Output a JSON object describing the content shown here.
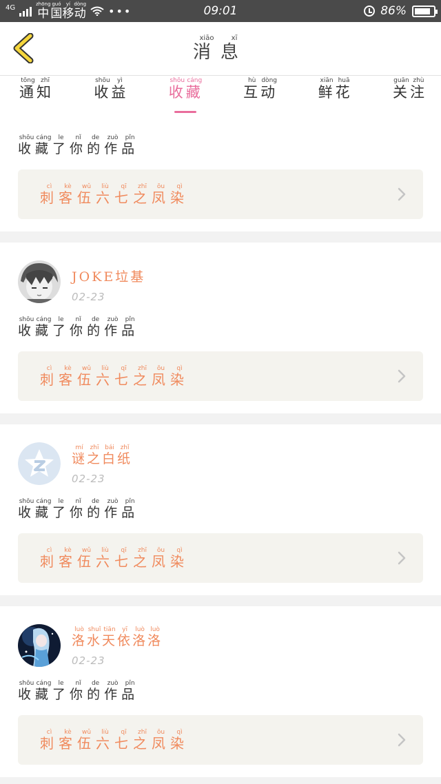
{
  "status_bar": {
    "network": "4G",
    "carrier": [
      {
        "ch": "中",
        "py": "zhōng"
      },
      {
        "ch": "国",
        "py": "guó"
      },
      {
        "ch": "移",
        "py": "yí"
      },
      {
        "ch": "动",
        "py": "dòng"
      }
    ],
    "dots": "•••",
    "time": "09:01",
    "battery": "86%",
    "battery_level": 0.86
  },
  "header": {
    "title": [
      {
        "ch": "消",
        "py": "xiāo"
      },
      {
        "ch": "息",
        "py": "xī"
      }
    ]
  },
  "tabs": [
    {
      "chars": [
        {
          "ch": "通",
          "py": "tōng"
        },
        {
          "ch": "知",
          "py": "zhī"
        }
      ],
      "active": false
    },
    {
      "chars": [
        {
          "ch": "收",
          "py": "shōu"
        },
        {
          "ch": "益",
          "py": "yì"
        }
      ],
      "active": false
    },
    {
      "chars": [
        {
          "ch": "收",
          "py": "shōu"
        },
        {
          "ch": "藏",
          "py": "cáng"
        }
      ],
      "active": true
    },
    {
      "chars": [
        {
          "ch": "互",
          "py": "hù"
        },
        {
          "ch": "动",
          "py": "dòng"
        }
      ],
      "active": false
    },
    {
      "chars": [
        {
          "ch": "鲜",
          "py": "xiān"
        },
        {
          "ch": "花",
          "py": "huā"
        }
      ],
      "active": false
    },
    {
      "chars": [
        {
          "ch": "关",
          "py": "guān"
        },
        {
          "ch": "注",
          "py": "zhù"
        }
      ],
      "active": false
    }
  ],
  "action_text": [
    {
      "ch": "收",
      "py": "shōu"
    },
    {
      "ch": "藏",
      "py": "cáng"
    },
    {
      "ch": "了",
      "py": "le"
    },
    {
      "ch": "你",
      "py": "nǐ"
    },
    {
      "ch": "的",
      "py": "de"
    },
    {
      "ch": "作",
      "py": "zuò"
    },
    {
      "ch": "品",
      "py": "pǐn"
    }
  ],
  "work_title": [
    {
      "ch": "刺",
      "py": "cì"
    },
    {
      "ch": "客",
      "py": "kè"
    },
    {
      "ch": "伍",
      "py": "wǔ"
    },
    {
      "ch": "六",
      "py": "liù"
    },
    {
      "ch": "七",
      "py": "qī"
    },
    {
      "ch": "之",
      "py": "zhī"
    },
    {
      "ch": "凤",
      "py": "ōu"
    },
    {
      "ch": "染",
      "py": "qì"
    }
  ],
  "notifications": [
    {
      "username": [
        {
          "ch": "JOKE",
          "py": ""
        },
        {
          "ch": "垃",
          "py": ""
        },
        {
          "ch": "基",
          "py": ""
        }
      ],
      "date": "02-23",
      "avatar": "anime-boy-avatar"
    },
    {
      "username": [
        {
          "ch": "谜",
          "py": "mí"
        },
        {
          "ch": "之",
          "py": "zhī"
        },
        {
          "ch": "白",
          "py": "bái"
        },
        {
          "ch": "纸",
          "py": "zhǐ"
        }
      ],
      "date": "02-23",
      "avatar": "default-qq-avatar"
    },
    {
      "username": [
        {
          "ch": "洛",
          "py": "luò"
        },
        {
          "ch": "水",
          "py": "shuǐ"
        },
        {
          "ch": "天",
          "py": "tiān"
        },
        {
          "ch": "依",
          "py": "yī"
        },
        {
          "ch": "洛",
          "py": "luò"
        },
        {
          "ch": "洛",
          "py": "luò"
        }
      ],
      "date": "02-23",
      "avatar": "luo-tianyi-avatar"
    }
  ],
  "colors": {
    "accent_pink": "#e96d9c",
    "accent_orange": "#f08a5d",
    "back_yellow": "#f5d63c",
    "work_box_bg": "#f4f3ee"
  }
}
